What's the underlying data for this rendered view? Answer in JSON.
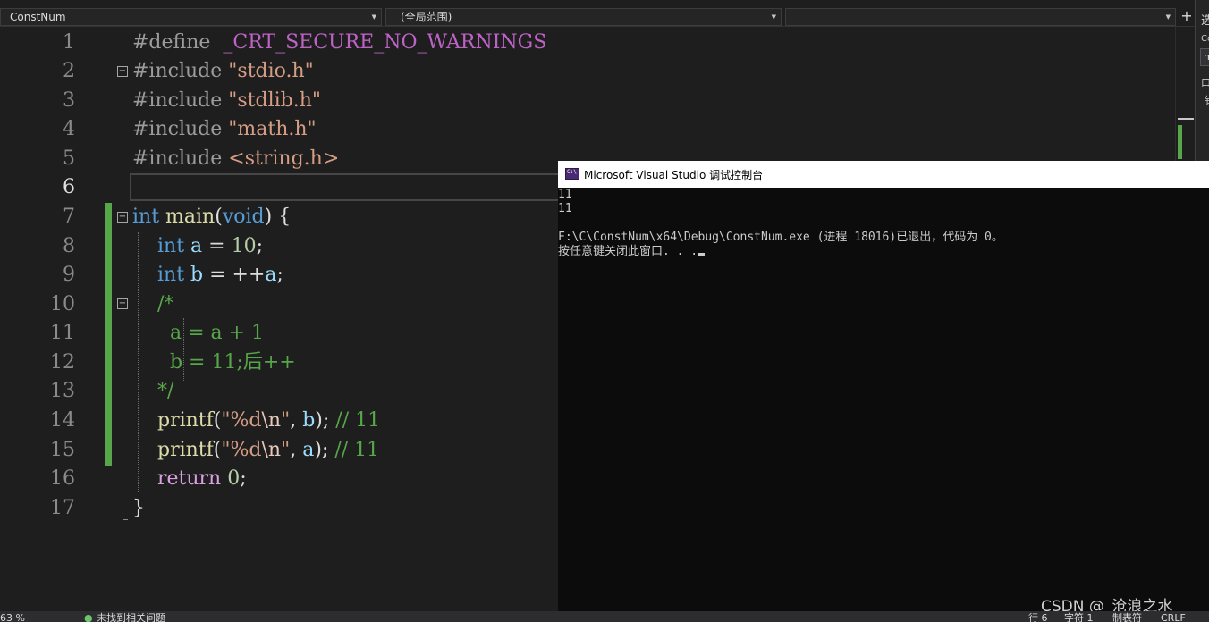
{
  "navbar": {
    "project": "ConstNum",
    "scope": "(全局范围)",
    "member": ""
  },
  "side_panel": {
    "title": "选",
    "label": "Co",
    "box": "m",
    "check": "口",
    "line": "钅"
  },
  "editor": {
    "line_numbers": [
      "1",
      "2",
      "3",
      "4",
      "5",
      "6",
      "7",
      "8",
      "9",
      "10",
      "11",
      "12",
      "13",
      "14",
      "15",
      "16",
      "17"
    ],
    "active_line": 6
  },
  "console": {
    "title": "Microsoft Visual Studio 调试控制台",
    "lines": [
      "11",
      "11",
      "",
      "F:\\C\\ConstNum\\x64\\Debug\\ConstNum.exe (进程 18016)已退出，代码为 0。",
      "按任意键关闭此窗口. . ."
    ],
    "watermark": "CSDN @_沧浪之水_"
  },
  "statusbar": {
    "zoom": "63 %",
    "issues": "未找到相关问题",
    "row": "行 6",
    "col": "字符 1",
    "mode": "制表符",
    "eol": "CRLF"
  },
  "colors": {
    "keyword": "#569cd6",
    "string": "#d69d85",
    "comment": "#57a64a",
    "number": "#b5cea8",
    "macro": "#bd63c5",
    "change_bar": "#57a64a"
  }
}
